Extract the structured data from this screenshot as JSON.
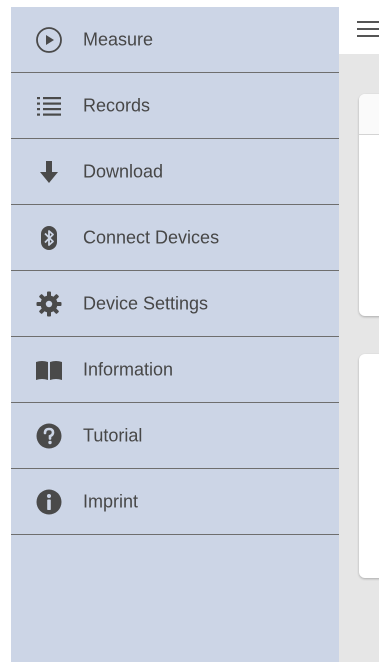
{
  "drawer": {
    "items": [
      {
        "label": "Measure",
        "icon": "play-circle-icon"
      },
      {
        "label": "Records",
        "icon": "list-icon"
      },
      {
        "label": "Download",
        "icon": "arrow-down-icon"
      },
      {
        "label": "Connect Devices",
        "icon": "bluetooth-icon"
      },
      {
        "label": "Device Settings",
        "icon": "gear-icon"
      },
      {
        "label": "Information",
        "icon": "book-icon"
      },
      {
        "label": "Tutorial",
        "icon": "question-icon"
      },
      {
        "label": "Imprint",
        "icon": "info-icon"
      }
    ]
  },
  "colors": {
    "drawer_bg": "#ccd5e6",
    "icon": "#4a4a4a",
    "divider": "#6e6e6e",
    "content_bg": "#e6e6e6"
  }
}
